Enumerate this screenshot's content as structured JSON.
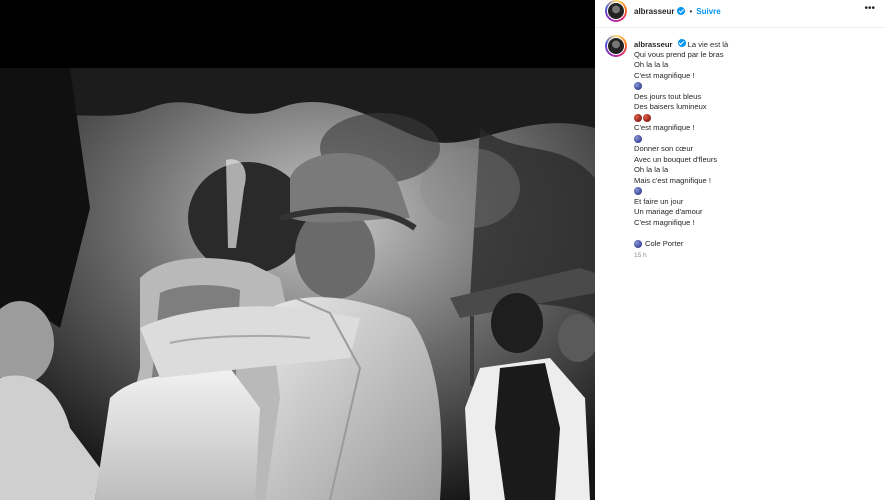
{
  "post": {
    "username": "albrasseur",
    "follow_label": "Suivre",
    "separator": "•",
    "more_label": "•••",
    "caption_title": "La vie est là",
    "caption_lines_1": [
      "Qui vous prend par le bras",
      "Oh la la la",
      "C'est magnifique !"
    ],
    "caption_lines_2": [
      "Des jours tout bleus",
      "Des baisers lumineux"
    ],
    "caption_lines_3": [
      "C'est magnifique !"
    ],
    "caption_lines_4": [
      "Donner son cœur",
      "Avec un bouquet d'fleurs",
      "Oh la la la",
      "Mais c'est magnifique !"
    ],
    "caption_lines_5": [
      "Et faire un jour",
      "Un mariage d'amour",
      "C'est magnifique !"
    ],
    "credit": "Cole Porter",
    "timestamp": "15 h"
  },
  "colors": {
    "link_blue": "#0095f6",
    "text": "#262626",
    "muted": "#8e8e8e"
  },
  "icons": {
    "verified": "verified-badge-icon",
    "emoji_blue": "blue-heart-emoji-icon",
    "emoji_red": "red-heart-emoji-icon",
    "more": "more-options-icon"
  }
}
